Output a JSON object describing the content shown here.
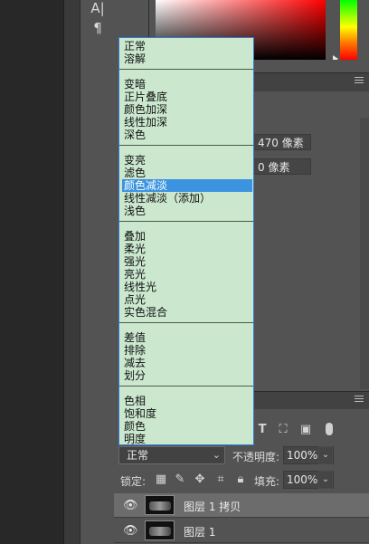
{
  "tools": {
    "type_tool_glyph": "A|",
    "paragraph_glyph": "¶"
  },
  "properties": {
    "width_value": "470 像素",
    "height_value": "0 像素"
  },
  "blend_menu": {
    "groups": [
      [
        "正常",
        "溶解"
      ],
      [
        "变暗",
        "正片叠底",
        "颜色加深",
        "线性加深",
        "深色"
      ],
      [
        "变亮",
        "滤色",
        "颜色减淡",
        "线性减淡（添加）",
        "浅色"
      ],
      [
        "叠加",
        "柔光",
        "强光",
        "亮光",
        "线性光",
        "点光",
        "实色混合"
      ],
      [
        "差值",
        "排除",
        "减去",
        "划分"
      ],
      [
        "色相",
        "饱和度",
        "颜色",
        "明度"
      ]
    ],
    "highlighted": "颜色减淡"
  },
  "layers_panel": {
    "blend_mode_value": "正常",
    "opacity_label": "不透明度:",
    "opacity_value": "100%",
    "lock_label": "锁定:",
    "fill_label": "填充:",
    "fill_value": "100%",
    "filter_icons": [
      "text-filter-icon",
      "transform-filter-icon",
      "smart-object-filter-icon"
    ],
    "lock_icons": [
      "lock-transparent-icon",
      "lock-paint-icon",
      "lock-move-icon",
      "lock-artboard-icon",
      "lock-all-icon"
    ],
    "layers": [
      {
        "name": "图层 1 拷贝",
        "selected": true
      },
      {
        "name": "图层 1",
        "selected": false
      }
    ]
  },
  "colors": {
    "menu_background": "#cbe8cf",
    "menu_highlight": "#3c93e0",
    "panel_background": "#535353"
  }
}
